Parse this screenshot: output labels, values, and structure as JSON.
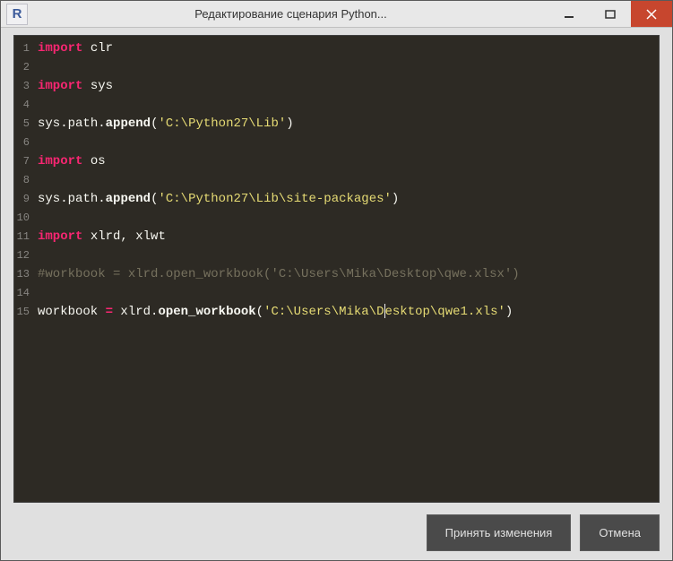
{
  "titlebar": {
    "app_icon_letter": "R",
    "title": "Редактирование сценария Python..."
  },
  "code": {
    "lines": [
      {
        "n": 1,
        "tokens": [
          {
            "t": "import",
            "c": "kw"
          },
          {
            "t": " ",
            "c": "id"
          },
          {
            "t": "clr",
            "c": "id"
          }
        ]
      },
      {
        "n": 2,
        "tokens": []
      },
      {
        "n": 3,
        "tokens": [
          {
            "t": "import",
            "c": "kw"
          },
          {
            "t": " ",
            "c": "id"
          },
          {
            "t": "sys",
            "c": "id"
          }
        ]
      },
      {
        "n": 4,
        "tokens": []
      },
      {
        "n": 5,
        "tokens": [
          {
            "t": "sys",
            "c": "id"
          },
          {
            "t": ".",
            "c": "punct"
          },
          {
            "t": "path",
            "c": "id"
          },
          {
            "t": ".",
            "c": "punct"
          },
          {
            "t": "append",
            "c": "fn"
          },
          {
            "t": "(",
            "c": "punct"
          },
          {
            "t": "'C:\\Python27\\Lib'",
            "c": "str"
          },
          {
            "t": ")",
            "c": "punct"
          }
        ]
      },
      {
        "n": 6,
        "tokens": []
      },
      {
        "n": 7,
        "tokens": [
          {
            "t": "import",
            "c": "kw"
          },
          {
            "t": " ",
            "c": "id"
          },
          {
            "t": "os",
            "c": "id"
          }
        ]
      },
      {
        "n": 8,
        "tokens": []
      },
      {
        "n": 9,
        "tokens": [
          {
            "t": "sys",
            "c": "id"
          },
          {
            "t": ".",
            "c": "punct"
          },
          {
            "t": "path",
            "c": "id"
          },
          {
            "t": ".",
            "c": "punct"
          },
          {
            "t": "append",
            "c": "fn"
          },
          {
            "t": "(",
            "c": "punct"
          },
          {
            "t": "'C:\\Python27\\Lib\\site-packages'",
            "c": "str"
          },
          {
            "t": ")",
            "c": "punct"
          }
        ]
      },
      {
        "n": 10,
        "tokens": []
      },
      {
        "n": 11,
        "tokens": [
          {
            "t": "import",
            "c": "kw"
          },
          {
            "t": " ",
            "c": "id"
          },
          {
            "t": "xlrd, xlwt",
            "c": "id"
          }
        ]
      },
      {
        "n": 12,
        "tokens": []
      },
      {
        "n": 13,
        "tokens": [
          {
            "t": "#workbook = xlrd.open_workbook('C:\\Users\\Mika\\Desktop\\qwe.xlsx')",
            "c": "com"
          }
        ]
      },
      {
        "n": 14,
        "tokens": []
      },
      {
        "n": 15,
        "tokens": [
          {
            "t": "workbook ",
            "c": "id"
          },
          {
            "t": "=",
            "c": "kw"
          },
          {
            "t": " xlrd",
            "c": "id"
          },
          {
            "t": ".",
            "c": "punct"
          },
          {
            "t": "open_workbook",
            "c": "fn"
          },
          {
            "t": "(",
            "c": "punct"
          },
          {
            "t": "'C:\\Users\\Mika\\D",
            "c": "str"
          },
          {
            "t": "",
            "c": "cursor"
          },
          {
            "t": "esktop\\qwe1.xls'",
            "c": "str"
          },
          {
            "t": ")",
            "c": "punct"
          }
        ]
      }
    ]
  },
  "buttons": {
    "accept": "Принять изменения",
    "cancel": "Отмена"
  }
}
